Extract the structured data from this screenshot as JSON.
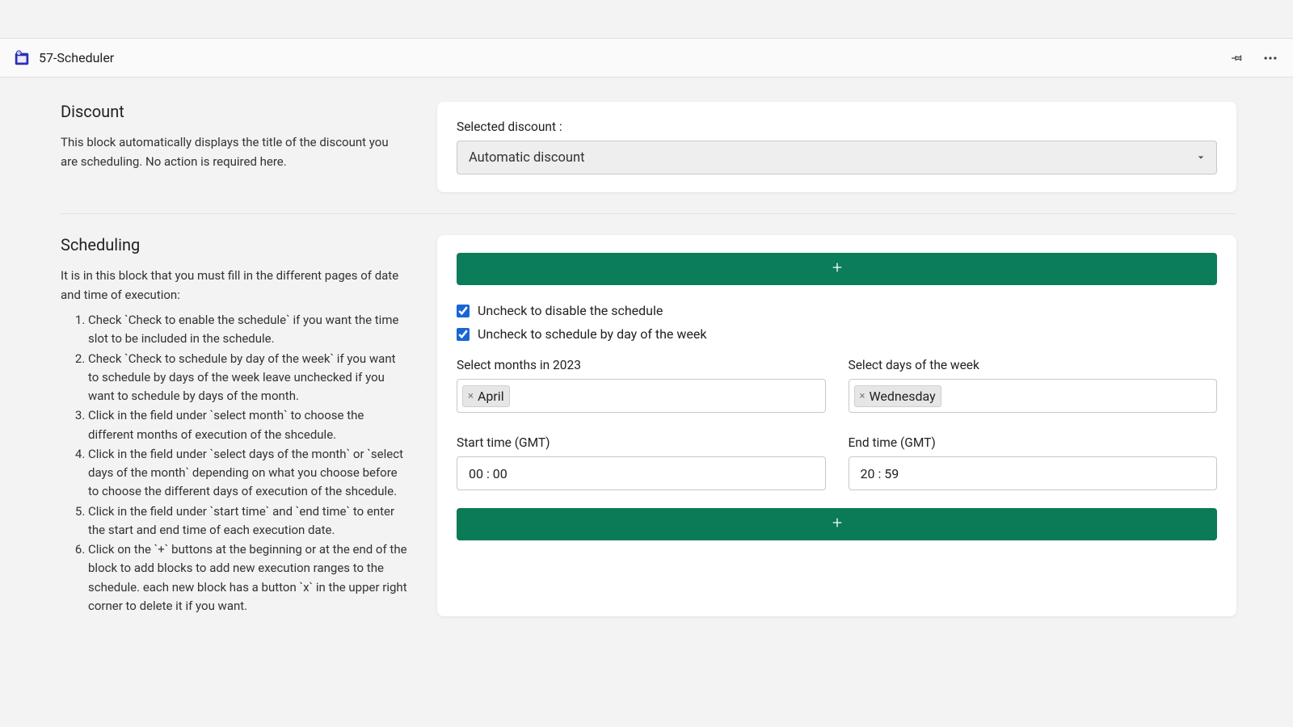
{
  "header": {
    "title": "57-Scheduler"
  },
  "discount": {
    "heading": "Discount",
    "desc": "This block automatically displays the title of the discount you are scheduling. No action is required here.",
    "selected_label": "Selected discount :",
    "selected_value": "Automatic discount"
  },
  "scheduling": {
    "heading": "Scheduling",
    "desc_intro": "It is in this block that you must fill in the different pages of date and time of execution:",
    "steps": [
      "Check `Check to enable the schedule` if you want the time slot to be included in the schedule.",
      "Check `Check to schedule by day of the week` if you want to schedule by days of the week leave unchecked if you want to schedule by days of the month.",
      "Click in the field under `select month` to choose the different months of execution of the shcedule.",
      "Click in the field under `select days of the month` or `select days of the month` depending on what you choose before to choose the different days of execution of the shcedule.",
      "Click in the field under `start time` and `end time` to enter the start and end time of each execution date.",
      "Click on the `+` buttons at the beginning or at the end of the block to add blocks to add new execution ranges to the schedule. each new block has a button `x` in the upper right corner to delete it if you want."
    ],
    "chk_enable": "Uncheck to disable the schedule",
    "chk_dayweek": "Uncheck to schedule by day of the week",
    "months_label": "Select months in 2023",
    "months_value": "April",
    "days_label": "Select days of the week",
    "days_value": "Wednesday",
    "start_label": "Start time (GMT)",
    "start_value": "00 : 00",
    "end_label": "End time (GMT)",
    "end_value": "20 : 59"
  },
  "colors": {
    "primary_green": "#0b7d5a",
    "checkbox_blue": "#1866d6"
  }
}
